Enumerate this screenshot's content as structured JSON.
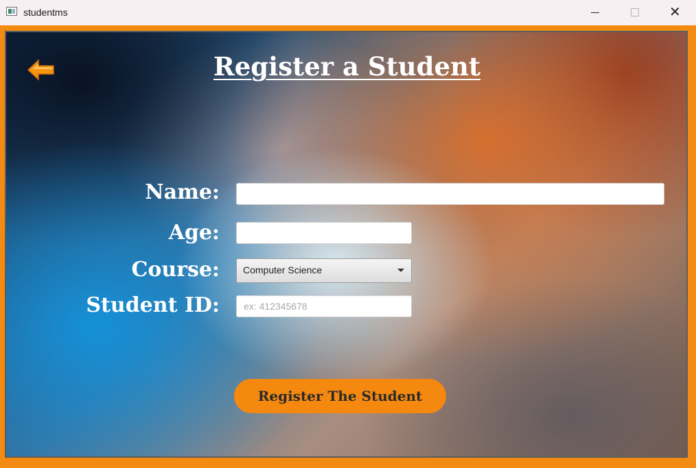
{
  "window": {
    "title": "studentms",
    "app_icon": "app-window-icon",
    "controls": {
      "minimize_icon": "minimize-icon",
      "maximize_icon": "maximize-icon",
      "close_icon": "close-icon",
      "close_glyph": "✕"
    }
  },
  "header": {
    "title": "Register a Student",
    "back_icon": "back-arrow-icon"
  },
  "form": {
    "name_label": "Name:",
    "name_value": "",
    "age_label": "Age:",
    "age_value": "",
    "course_label": "Course:",
    "course_selected": "Computer Science",
    "student_id_label": "Student ID:",
    "student_id_placeholder": "ex: 412345678",
    "student_id_value": "",
    "submit_label": "Register The Student"
  },
  "colors": {
    "accent_orange": "#f5890f",
    "frame_orange": "#f38a12",
    "title_text": "#ffffff"
  }
}
